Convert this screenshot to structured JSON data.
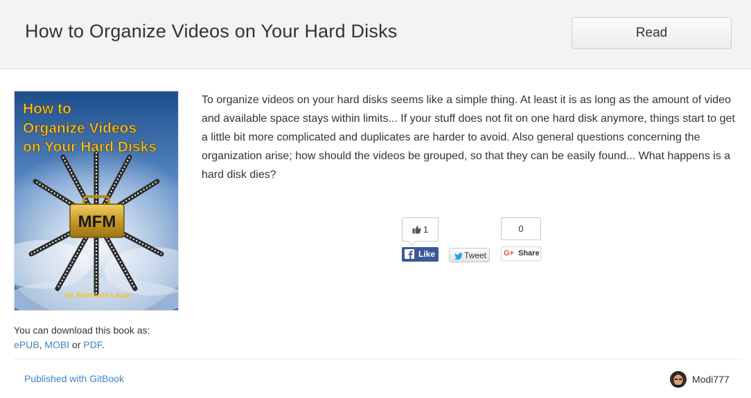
{
  "header": {
    "title": "How to Organize Videos on Your Hard Disks",
    "read_label": "Read"
  },
  "cover": {
    "title_line1": "How to",
    "title_line2": "Organize Videos",
    "title_line3": "on Your Hard Disks",
    "logo_text": "MFM",
    "author": "by Reinhold Lauer",
    "title_color": "#f2c230"
  },
  "download": {
    "prefix": "You can download this book as:",
    "epub": "ePUB",
    "sep1": ",",
    "mobi": "MOBI",
    "or": "or",
    "pdf": "PDF",
    "end": "."
  },
  "description": "To organize videos on your hard disks seems like a simple thing. At least it is as long as the amount of video and available space stays within limits... If your stuff does not fit on one hard disk anymore, things start to get a little bit more complicated and duplicates are harder to avoid. Also general questions concerning the organization arise; how should the videos be grouped, so that they can be easily found... What happens is a hard disk dies?",
  "social": {
    "like_count": "1",
    "like_label": "Like",
    "tweet_label": "Tweet",
    "share_count": "0",
    "share_label": "Share",
    "facebook_color": "#3b5998",
    "twitter_color": "#1da1f2",
    "google_color": "#dd4b39"
  },
  "footer": {
    "published": "Published with GitBook",
    "author_name": "Modi777"
  },
  "colors": {
    "link": "#4183c4",
    "header_bg": "#f3f3f3"
  }
}
